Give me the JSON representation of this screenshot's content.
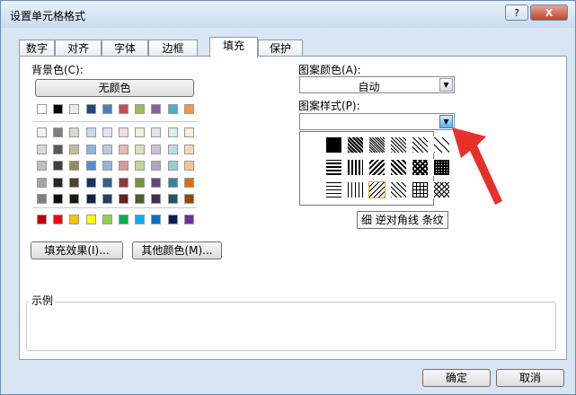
{
  "window": {
    "title": "设置单元格格式",
    "help": "?",
    "close": "X"
  },
  "tabs": [
    {
      "label": "数字"
    },
    {
      "label": "对齐"
    },
    {
      "label": "字体"
    },
    {
      "label": "边框"
    },
    {
      "label": "填充",
      "active": true
    },
    {
      "label": "保护"
    }
  ],
  "fill": {
    "background_label": "背景色(C):",
    "no_color_button": "无颜色",
    "fill_effects_button": "填充效果(I)...",
    "more_colors_button": "其他颜色(M)...",
    "pattern_color_label": "图案颜色(A):",
    "pattern_color_value": "自动",
    "pattern_style_label": "图案样式(P):",
    "pattern_style_value": "",
    "selected_pattern_tooltip": "细 逆对角线 条纹",
    "sample_label": "示例"
  },
  "buttons": {
    "ok": "确定",
    "cancel": "取消"
  },
  "palette": {
    "theme_top_row": [
      "#ffffff",
      "#000000",
      "#eeece1",
      "#1f497d",
      "#4f81bd",
      "#c0504d",
      "#9bbb59",
      "#8064a2",
      "#4bacc6",
      "#f79646"
    ],
    "theme_shades": [
      [
        "#f2f2f2",
        "#7f7f7f",
        "#ddd9c3",
        "#c6d9f0",
        "#dbe5f1",
        "#f2dcdb",
        "#ebf1dd",
        "#e5e0ec",
        "#dbeef3",
        "#fdeada"
      ],
      [
        "#d8d8d8",
        "#595959",
        "#c4bd97",
        "#8db3e2",
        "#b8cce4",
        "#e5b9b7",
        "#d7e3bc",
        "#ccc1d9",
        "#b7dde8",
        "#fbd5b5"
      ],
      [
        "#bfbfbf",
        "#3f3f3f",
        "#938953",
        "#548dd4",
        "#95b3d7",
        "#d99694",
        "#c3d69b",
        "#b2a2c7",
        "#92cddc",
        "#fac08f"
      ],
      [
        "#a5a5a5",
        "#262626",
        "#494429",
        "#17365d",
        "#366092",
        "#953734",
        "#76923c",
        "#5f497a",
        "#31859b",
        "#e36c09"
      ],
      [
        "#7f7f7f",
        "#0c0c0c",
        "#1d1b10",
        "#0f243e",
        "#244061",
        "#632423",
        "#4f6128",
        "#3f3151",
        "#205867",
        "#974806"
      ]
    ],
    "standard_colors": [
      "#c00000",
      "#ff0000",
      "#ffc000",
      "#ffff00",
      "#92d050",
      "#00b050",
      "#00b0f0",
      "#0070c0",
      "#002060",
      "#7030a0"
    ]
  },
  "patterns": [
    "solid",
    "75-gray",
    "50-gray",
    "25-gray",
    "12-gray",
    "6-gray",
    "horizontal-thick",
    "vertical-thick",
    "reverse-diagonal-thick",
    "diagonal-thick",
    "diagonal-crosshatch",
    "thick-crosshatch",
    "horizontal-thin",
    "vertical-thin",
    "reverse-diagonal-thin",
    "diagonal-thin",
    "crosshatch-thin",
    "diagonal-crosshatch-thin"
  ],
  "selected_pattern_index": 14,
  "colors": {
    "accent_red": "#e8302a",
    "dialog_bg": "#d8e5f3"
  }
}
